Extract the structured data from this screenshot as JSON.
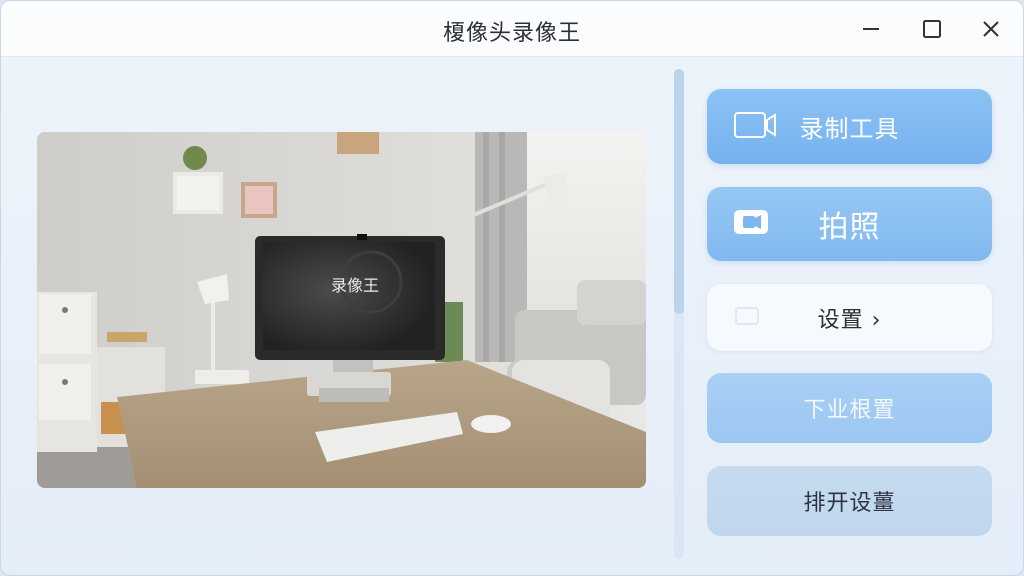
{
  "window": {
    "title": "榎像头录像王"
  },
  "titlebar": {
    "minimize_icon": "minimize-icon",
    "maximize_icon": "maximize-icon",
    "close_icon": "close-icon"
  },
  "preview": {
    "monitor_text": "录像王"
  },
  "sidebar": {
    "record_tools": {
      "label": "录制工具",
      "icon": "video-camera-icon"
    },
    "take_photo": {
      "label": "拍照",
      "icon": "camera-icon"
    },
    "settings": {
      "label": "设置 ›",
      "icon": "placeholder-icon"
    },
    "button_three": {
      "label": "下业根置"
    },
    "button_four": {
      "label": "排开设薑"
    }
  },
  "colors": {
    "accent": "#76b2ef",
    "accent_light": "#96c7f4",
    "background": "#e8f0f9",
    "titlebar": "#fbfcfe"
  }
}
